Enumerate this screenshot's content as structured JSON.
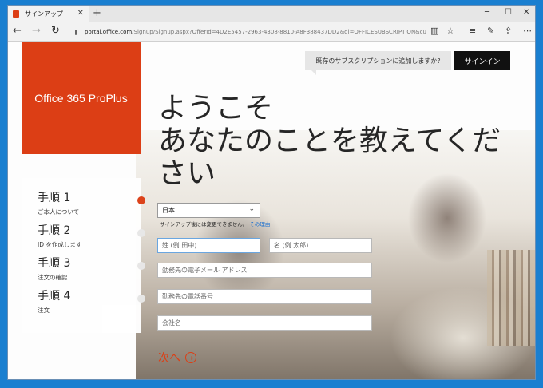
{
  "browser": {
    "tab_title": "サインアップ",
    "address_host": "portal.office.com",
    "address_path": "/Signup/Signup.aspx?OfferId=4D2E5457-2963-4308-8810-A8F388437DD2&dl=OFFICESUBSCRIPTION&culture=ja-JP&country=JP#"
  },
  "page": {
    "product_name": "Office 365 ProPlus",
    "existing_prompt": "既存のサブスクリプションに追加しますか?",
    "signin_label": "サインイン",
    "heading_line1": "ようこそ",
    "heading_line2": "あなたのことを教えてくだ",
    "heading_line3": "さい",
    "steps": [
      {
        "title": "手順 1",
        "subtitle": "ご本人について",
        "active": true
      },
      {
        "title": "手順 2",
        "subtitle": "ID を作成します",
        "active": false
      },
      {
        "title": "手順 3",
        "subtitle": "注文の確認",
        "active": false
      },
      {
        "title": "手順 4",
        "subtitle": "注文",
        "active": false
      }
    ],
    "country_value": "日本",
    "country_hint": "サインアップ後には変更できません。",
    "country_hint_link": "その理由",
    "last_name_placeholder": "姓 (例 田中)",
    "first_name_placeholder": "名 (例 太郎)",
    "email_placeholder": "勤務先の電子メール アドレス",
    "phone_placeholder": "勤務先の電話番号",
    "company_placeholder": "会社名",
    "next_label": "次へ"
  }
}
